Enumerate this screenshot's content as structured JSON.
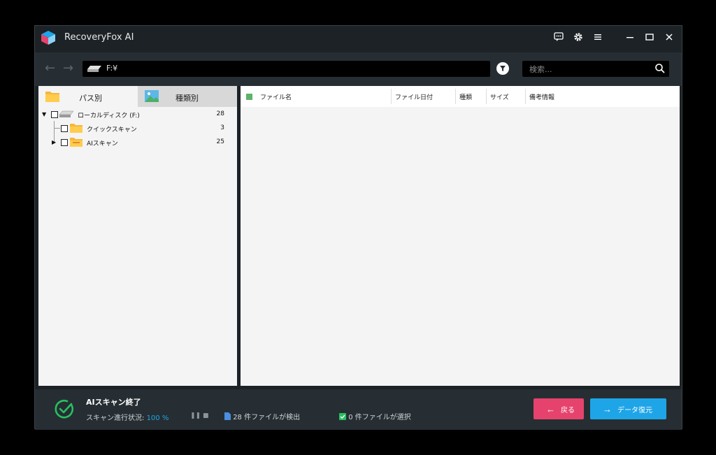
{
  "window": {
    "title": "RecoveryFox AI"
  },
  "titlebar": {
    "icons": [
      "feedback-icon",
      "settings-icon",
      "menu-icon",
      "minimize-icon",
      "maximize-icon",
      "close-icon"
    ]
  },
  "toolbar": {
    "path": "F:¥",
    "search_placeholder": "検索..."
  },
  "tabs": [
    {
      "label": "パス別",
      "icon": "folder-icon"
    },
    {
      "label": "種類別",
      "icon": "image-icon"
    }
  ],
  "tree": [
    {
      "label": "ローカルディスク (F:)",
      "count": "28",
      "icon": "drive-icon"
    },
    {
      "label": "クイックスキャン",
      "count": "3",
      "icon": "folder-icon"
    },
    {
      "label": "AIスキャン",
      "count": "25",
      "icon": "folder-icon"
    }
  ],
  "columns": [
    "ファイル名",
    "ファイル日付",
    "種類",
    "サイズ",
    "備考情報"
  ],
  "status": {
    "title": "AIスキャン終了",
    "progress_label": "スキャン進行状況: ",
    "progress_value": "100 %",
    "progress": 1.0,
    "found": "28 件ファイルが検出",
    "selected": "0 件ファイルが選択"
  },
  "buttons": {
    "back": "戻る",
    "recover": "データ復元"
  },
  "colors": {
    "accent": "#1ea5e8",
    "back": "#e5436d",
    "success": "#27c05f"
  }
}
